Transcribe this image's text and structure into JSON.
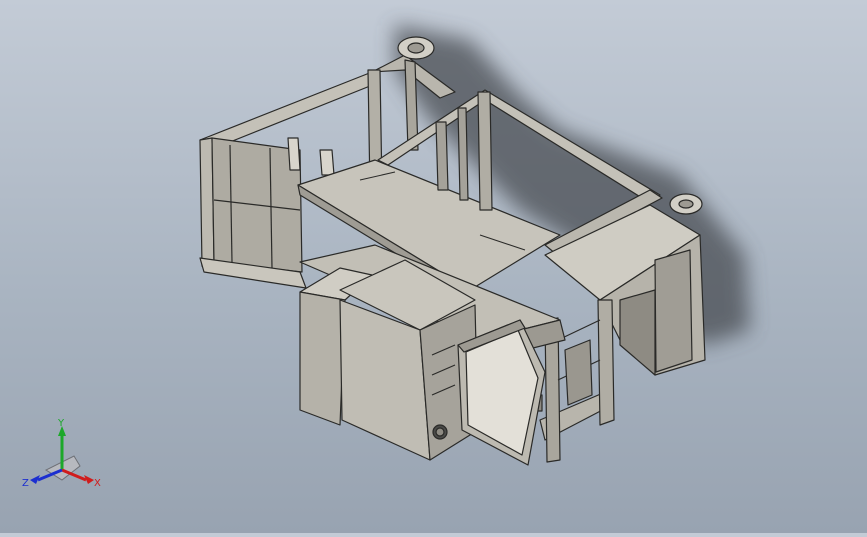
{
  "viewport": {
    "background_top": "#c3cbd6",
    "background_bottom": "#98a3b1",
    "model_fill": "#c4c1b8",
    "model_fill_dark": "#8e8b83",
    "model_edge": "#2a2a28",
    "shadow": "#4a4d52"
  },
  "triad": {
    "x_label": "X",
    "y_label": "Y",
    "z_label": "Z",
    "x_color": "#d01c1c",
    "y_color": "#1ca82a",
    "z_color": "#1c2fd0"
  }
}
